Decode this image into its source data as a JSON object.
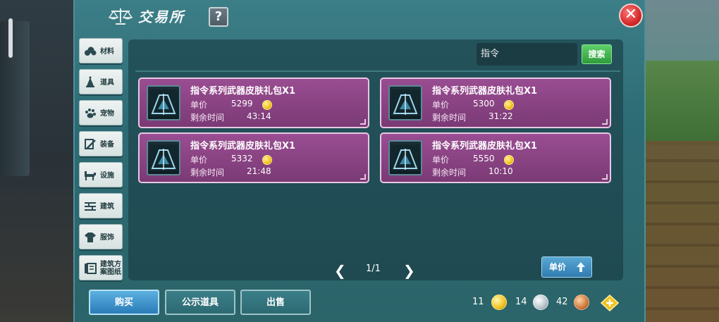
{
  "window": {
    "title": "交易所",
    "help_label": "?",
    "close_label": "✕"
  },
  "sidebar": {
    "items": [
      {
        "label": "材料",
        "icon": "cotton-icon"
      },
      {
        "label": "道具",
        "icon": "bell-icon"
      },
      {
        "label": "宠物",
        "icon": "paw-icon"
      },
      {
        "label": "装备",
        "icon": "sword-icon"
      },
      {
        "label": "设施",
        "icon": "horse-icon"
      },
      {
        "label": "建筑",
        "icon": "wall-icon"
      },
      {
        "label": "服饰",
        "icon": "shirt-icon"
      },
      {
        "label": "建筑方案图纸",
        "icon": "blueprint-icon"
      }
    ]
  },
  "search": {
    "value": "指令",
    "button_label": "搜索"
  },
  "listings": [
    {
      "name": "指令系列武器皮肤礼包X1",
      "price_label": "单价",
      "price": "5299",
      "time_label": "剩余时间",
      "time": "43:14"
    },
    {
      "name": "指令系列武器皮肤礼包X1",
      "price_label": "单价",
      "price": "5300",
      "time_label": "剩余时间",
      "time": "31:22"
    },
    {
      "name": "指令系列武器皮肤礼包X1",
      "price_label": "单价",
      "price": "5332",
      "time_label": "剩余时间",
      "time": "21:48"
    },
    {
      "name": "指令系列武器皮肤礼包X1",
      "price_label": "单价",
      "price": "5550",
      "time_label": "剩余时间",
      "time": "10:10"
    }
  ],
  "pagination": {
    "label": "1/1",
    "prev": "❮",
    "next": "❯"
  },
  "sort": {
    "label": "单价"
  },
  "actions": {
    "buy": "购买",
    "publicize": "公示道具",
    "sell": "出售"
  },
  "currency": {
    "gold": "11",
    "silver": "14",
    "copper": "42",
    "colors": {
      "gold": "#f0c420",
      "silver": "#b9c4cc",
      "copper": "#cf7a3c"
    }
  }
}
